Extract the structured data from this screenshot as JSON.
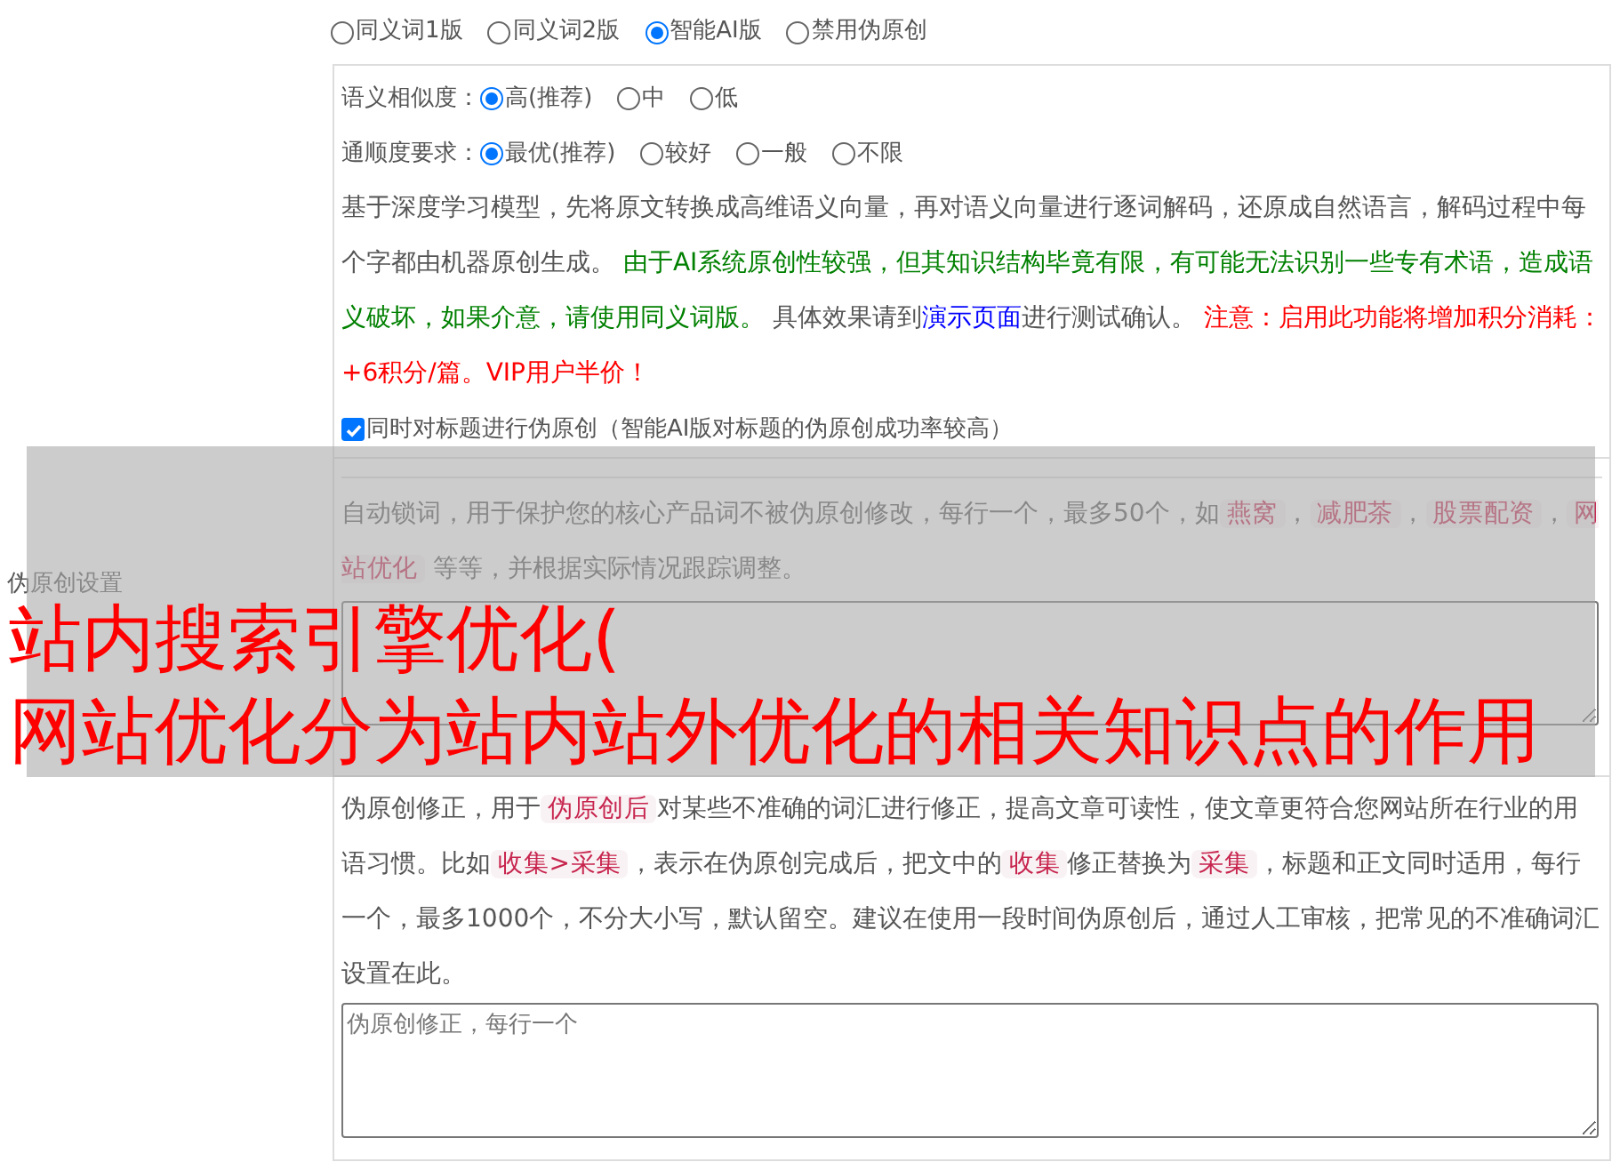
{
  "side_label": "伪原创设置",
  "modes": [
    {
      "label": "同义词1版",
      "selected": false
    },
    {
      "label": "同义词2版",
      "selected": false
    },
    {
      "label": "智能AI版",
      "selected": true
    },
    {
      "label": "禁用伪原创",
      "selected": false
    }
  ],
  "ai_settings": {
    "similarity": {
      "label": "语义相似度：",
      "options": [
        {
          "label": "高(推荐)",
          "selected": true
        },
        {
          "label": "中",
          "selected": false
        },
        {
          "label": "低",
          "selected": false
        }
      ]
    },
    "fluency": {
      "label": "通顺度要求：",
      "options": [
        {
          "label": "最优(推荐)",
          "selected": true
        },
        {
          "label": "较好",
          "selected": false
        },
        {
          "label": "一般",
          "selected": false
        },
        {
          "label": "不限",
          "selected": false
        }
      ]
    },
    "description": [
      {
        "kind": "plain",
        "text": "基于深度学习模型，先将原文转换成高维语义向量，再对语义向量进行逐词解码，还原成自然语言，解码过程中每个字都由机器原创生成。 "
      },
      {
        "kind": "warning",
        "text": "由于AI系统原创性较强，但其知识结构毕竟有限，有可能无法识别一些专有术语，造成语义破坏，如果介意，请使用同义词版。"
      },
      {
        "kind": "plain",
        "text": " 具体效果请到"
      },
      {
        "kind": "link",
        "text": "演示页面"
      },
      {
        "kind": "plain",
        "text": "进行测试确认。 "
      },
      {
        "kind": "alert",
        "text": "注意：启用此功能将增加积分消耗：+6积分/篇。VIP用户半价！"
      }
    ],
    "title_option": {
      "label": "同时对标题进行伪原创（智能AI版对标题的伪原创成功率较高）",
      "checked": true
    }
  },
  "lock_words": {
    "description": [
      {
        "kind": "plain",
        "text": "自动锁词，用于保护您的核心产品词不被伪原创修改，每行一个，最多50个，如"
      },
      {
        "kind": "tag",
        "text": "燕窝"
      },
      {
        "kind": "plain",
        "text": "，"
      },
      {
        "kind": "tag",
        "text": "减肥茶"
      },
      {
        "kind": "plain",
        "text": "，"
      },
      {
        "kind": "tag",
        "text": "股票配资"
      },
      {
        "kind": "plain",
        "text": "，"
      },
      {
        "kind": "tag",
        "text": "网站优化"
      },
      {
        "kind": "plain",
        "text": " 等等，并根据实际情况跟踪调整。"
      }
    ]
  },
  "corrections": {
    "description": [
      {
        "kind": "plain",
        "text": "伪原创修正，用于"
      },
      {
        "kind": "tag",
        "text": "伪原创后"
      },
      {
        "kind": "plain",
        "text": "对某些不准确的词汇进行修正，提高文章可读性，使文章更符合您网站所在行业的用语习惯。比如"
      },
      {
        "kind": "tag",
        "text": "收集>采集"
      },
      {
        "kind": "plain",
        "text": "，表示在伪原创完成后，把文中的"
      },
      {
        "kind": "tag",
        "text": "收集"
      },
      {
        "kind": "plain",
        "text": "修正替换为"
      },
      {
        "kind": "tag",
        "text": "采集"
      },
      {
        "kind": "plain",
        "text": "，标题和正文同时适用，每行一个，最多1000个，不分大小写，默认留空。建议在使用一段时间伪原创后，通过人工审核，把常见的不准确词汇设置在此。"
      }
    ],
    "placeholder": "伪原创修正，每行一个"
  },
  "overlay_title": [
    "站内搜索引擎优化(",
    "网站优化分为站内站外优化的相关知识点的作用"
  ]
}
